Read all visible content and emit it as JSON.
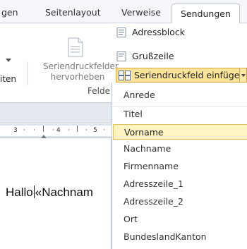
{
  "tabs": {
    "partial_left": "gen",
    "seitenlayout": "Seitenlayout",
    "verweise": "Verweise",
    "sendungen": "Sendungen"
  },
  "ribbon": {
    "left_partial_label": "iten",
    "highlight_button_line1": "Seriendruckfelder",
    "highlight_button_line2": "hervorheben",
    "group_label": "Felde",
    "adressblock": "Adressblock",
    "grusszeile": "Grußzeile",
    "insert_field": "Seriendruckfeld einfügen"
  },
  "ruler": {
    "marks": [
      "3",
      "4",
      "5"
    ]
  },
  "document": {
    "text_before": "Hallo",
    "text_after": "«Nachnam"
  },
  "dropdown": {
    "items": [
      "Anrede",
      "Titel",
      "Vorname",
      "Nachname",
      "Firmenname",
      "Adresszeile_1",
      "Adresszeile_2",
      "Ort",
      "BundeslandKanton"
    ],
    "highlighted": "Vorname"
  },
  "colors": {
    "highlight_bg": "#fff4c2",
    "highlight_border": "#e7c15a",
    "button_active_bg": "#fbe49a"
  }
}
